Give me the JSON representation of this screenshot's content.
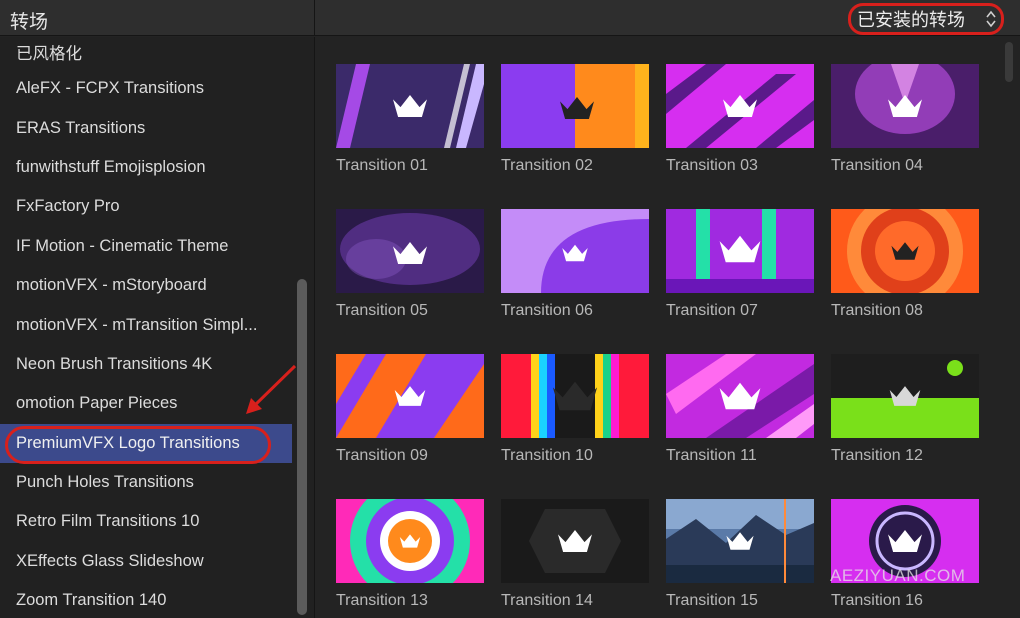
{
  "header": {
    "title": "转场",
    "category_select": "已安装的转场"
  },
  "sidebar": {
    "items": [
      {
        "label": "已风格化"
      },
      {
        "label": "AleFX - FCPX Transitions"
      },
      {
        "label": "ERAS Transitions"
      },
      {
        "label": "funwithstuff Emojisplosion"
      },
      {
        "label": "FxFactory Pro"
      },
      {
        "label": "IF Motion - Cinematic Theme"
      },
      {
        "label": "motionVFX - mStoryboard"
      },
      {
        "label": "motionVFX - mTransition Simpl..."
      },
      {
        "label": "Neon Brush Transitions 4K"
      },
      {
        "label": "omotion Paper Pieces"
      },
      {
        "label": "PremiumVFX Logo Transitions",
        "selected": true
      },
      {
        "label": "Punch Holes Transitions"
      },
      {
        "label": "Retro Film Transitions 10"
      },
      {
        "label": "XEffects Glass Slideshow"
      },
      {
        "label": "Zoom Transition 140"
      }
    ]
  },
  "transitions": [
    {
      "label": "Transition 01",
      "style": "purple-diagonal"
    },
    {
      "label": "Transition 02",
      "style": "violet-orange-split"
    },
    {
      "label": "Transition 03",
      "style": "magenta-slashes"
    },
    {
      "label": "Transition 04",
      "style": "purple-glow"
    },
    {
      "label": "Transition 05",
      "style": "smoky-purple"
    },
    {
      "label": "Transition 06",
      "style": "lilac-curve"
    },
    {
      "label": "Transition 07",
      "style": "teal-stripes"
    },
    {
      "label": "Transition 08",
      "style": "orange-rings"
    },
    {
      "label": "Transition 09",
      "style": "orange-violet-bands"
    },
    {
      "label": "Transition 10",
      "style": "rgb-bars"
    },
    {
      "label": "Transition 11",
      "style": "pink-brush"
    },
    {
      "label": "Transition 12",
      "style": "lime-dark"
    },
    {
      "label": "Transition 13",
      "style": "target-rings"
    },
    {
      "label": "Transition 14",
      "style": "dark-hex"
    },
    {
      "label": "Transition 15",
      "style": "mountain-photo"
    },
    {
      "label": "Transition 16",
      "style": "magenta-circle"
    }
  ],
  "watermark": "AEZIYUAN.COM",
  "colors": {
    "accent_annotation": "#d8201c",
    "selection": "#3c4a8c"
  }
}
